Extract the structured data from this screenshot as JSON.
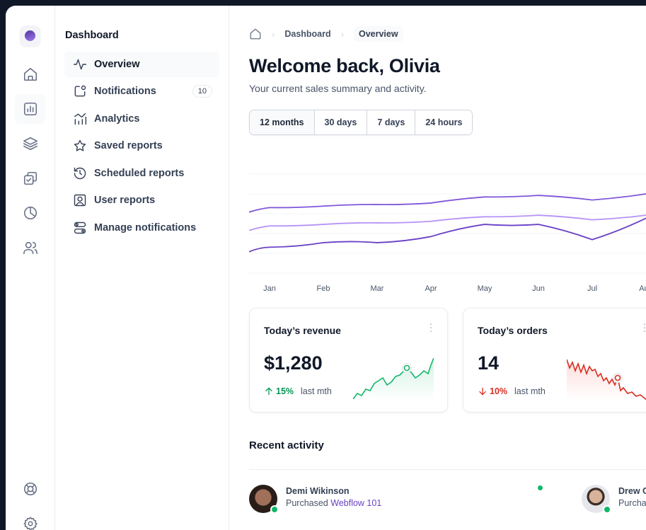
{
  "sidebar_rail": {
    "icons": [
      "logo-icon",
      "home-icon",
      "bar-chart-icon",
      "layers-icon",
      "check-copy-icon",
      "pie-chart-icon",
      "users-icon",
      "life-buoy-icon",
      "settings-icon"
    ]
  },
  "subnav": {
    "title": "Dashboard",
    "items": [
      {
        "label": "Overview",
        "icon": "activity-icon"
      },
      {
        "label": "Notifications",
        "icon": "notification-box-icon",
        "badge": "10"
      },
      {
        "label": "Analytics",
        "icon": "analytics-icon"
      },
      {
        "label": "Saved reports",
        "icon": "star-icon"
      },
      {
        "label": "Scheduled reports",
        "icon": "clock-rewind-icon"
      },
      {
        "label": "User reports",
        "icon": "user-square-icon"
      },
      {
        "label": "Manage notifications",
        "icon": "toggle-icon"
      }
    ]
  },
  "breadcrumb": {
    "items": [
      "Dashboard",
      "Overview"
    ]
  },
  "header": {
    "title": "Welcome back, Olivia",
    "subtitle": "Your current sales summary and activity."
  },
  "range_tabs": [
    "12 months",
    "30 days",
    "7 days",
    "24 hours"
  ],
  "colors": {
    "series_dark": "#6941c6",
    "series_mid": "#7f56d9",
    "series_light": "#b692f6",
    "up": "#039855",
    "down": "#d92d20"
  },
  "chart_data": {
    "type": "line",
    "categories": [
      "Jan",
      "Feb",
      "Mar",
      "Apr",
      "May",
      "Jun",
      "Jul",
      "Aug"
    ],
    "grid": true,
    "series": [
      {
        "values": [
          63,
          64,
          65,
          66,
          70,
          71,
          68,
          72
        ]
      },
      {
        "values": [
          51,
          52,
          53,
          54,
          57,
          58,
          55,
          58
        ]
      },
      {
        "values": [
          37,
          40,
          40,
          44,
          52,
          52,
          42,
          56
        ]
      }
    ],
    "ylim": [
      20,
      85
    ]
  },
  "cards": [
    {
      "title": "Today’s revenue",
      "value": "$1,280",
      "pct": "15%",
      "direction": "up",
      "period": "last mth"
    },
    {
      "title": "Today’s orders",
      "value": "14",
      "pct": "10%",
      "direction": "down",
      "period": "last mth"
    }
  ],
  "recent": {
    "title": "Recent activity",
    "items": [
      {
        "name": "Demi Wikinson",
        "action": "Purchased",
        "link": "Webflow 101"
      },
      {
        "name": "Drew C",
        "action": "Purcha",
        "link": ""
      }
    ]
  }
}
